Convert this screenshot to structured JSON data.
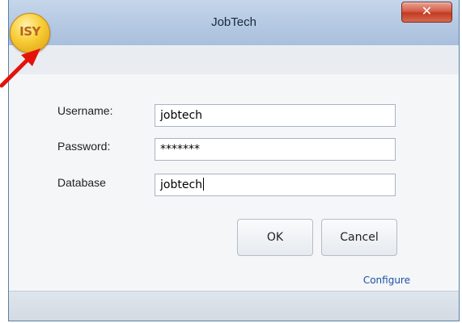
{
  "window": {
    "title": "JobTech",
    "close_glyph": "✕"
  },
  "logo": {
    "text": "ISY",
    "icon": "isy-logo-icon",
    "colors": {
      "fill": "#f8cc35",
      "text": "#b5651d"
    }
  },
  "annotation": {
    "icon": "red-arrow-icon",
    "color": "#e3130b"
  },
  "form": {
    "username": {
      "label": "Username:",
      "value": "jobtech"
    },
    "password": {
      "label": "Password:",
      "value": "*******"
    },
    "database": {
      "label": "Database",
      "value": "jobtech"
    }
  },
  "buttons": {
    "ok": "OK",
    "cancel": "Cancel"
  },
  "configure": "Configure",
  "colors": {
    "link": "#1f4fa8",
    "close_button": "#d65e48",
    "titlebar": "#b7cbe4"
  }
}
